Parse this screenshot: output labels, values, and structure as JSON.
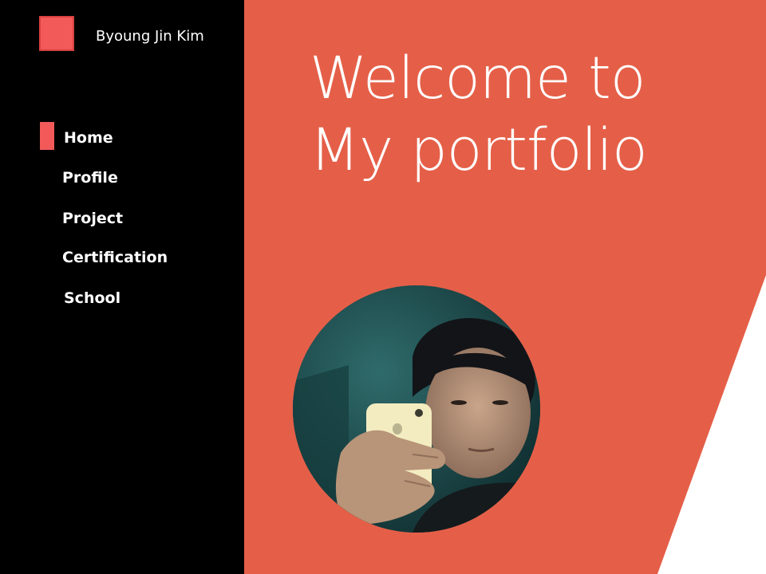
{
  "header": {
    "author_name": "Byoung Jin Kim"
  },
  "nav": {
    "items": [
      {
        "label": "Home",
        "active": true
      },
      {
        "label": "Profile",
        "active": false
      },
      {
        "label": "Project",
        "active": false
      },
      {
        "label": "Certification",
        "active": false
      },
      {
        "label": "School",
        "active": false
      }
    ]
  },
  "hero": {
    "line1": "Welcome to",
    "line2": "My portfolio"
  },
  "colors": {
    "accent": "#f25a5a",
    "main_bg": "#e55f48",
    "sidebar_bg": "#000000",
    "text": "#ffffff"
  },
  "icons": {
    "logo": "square-logo-icon"
  }
}
